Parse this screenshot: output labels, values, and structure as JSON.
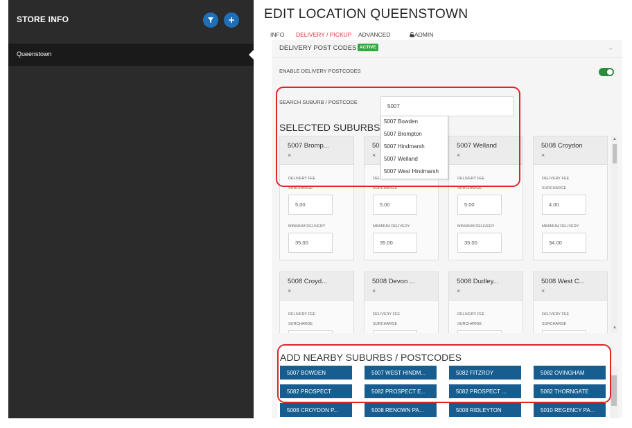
{
  "sidebar": {
    "title": "STORE INFO",
    "filter_icon": "filter-icon",
    "add_icon": "plus-icon",
    "items": [
      {
        "label": "Queenstown"
      }
    ]
  },
  "page": {
    "title": "EDIT LOCATION QUEENSTOWN"
  },
  "tabs": [
    {
      "label": "INFO"
    },
    {
      "label": "DELIVERY / PICKUP"
    },
    {
      "label": "ADVANCED"
    },
    {
      "label": "ADMIN"
    }
  ],
  "delivery": {
    "section_title": "DELIVERY POST CODES",
    "status_badge": "ACTIVE",
    "enable_label": "ENABLE DELIVERY POSTCODES",
    "enabled": true,
    "search_label": "SEARCH SUBURB / POSTCODE",
    "search_value": "5007",
    "selected_heading": "SELECTED SUBURBS",
    "suggestions": [
      "5007 Bowden",
      "5007 Brompton",
      "5007 Hindmarsh",
      "5007 Welland",
      "5007 West Hindmarsh"
    ],
    "fee_label": "DELIVERY FEE",
    "surcharge_label": "SURCHARGE",
    "min_label": "MINIMUM DELIVERY",
    "remove_symbol": "×",
    "cards": [
      {
        "name": "5007 Bromp...",
        "surcharge": "5.00",
        "minimum": "35.00"
      },
      {
        "name": "50",
        "surcharge": "5.00",
        "minimum": "35.00"
      },
      {
        "name": "5007 Welland",
        "surcharge": "5.00",
        "minimum": "35.00"
      },
      {
        "name": "5008 Croydon",
        "surcharge": "4.00",
        "minimum": "34.00"
      },
      {
        "name": "5008 Croyd...",
        "surcharge": "",
        "minimum": ""
      },
      {
        "name": "5008 Devon ...",
        "surcharge": "",
        "minimum": ""
      },
      {
        "name": "5008 Dudley...",
        "surcharge": "",
        "minimum": ""
      },
      {
        "name": "5008 West C...",
        "surcharge": "",
        "minimum": ""
      }
    ]
  },
  "nearby": {
    "title": "ADD NEARBY SUBURBS / POSTCODES",
    "buttons": [
      "5007 BOWDEN",
      "5007 WEST HINDM...",
      "5082 FITZROY",
      "5082 OVINGHAM",
      "5082 PROSPECT",
      "5082 PROSPECT E...",
      "5082 PROSPECT ...",
      "5082 THORNGATE",
      "5008 CROYDON P...",
      "5008 RENOWN PA...",
      "5008 RIDLEYTON",
      "5010 REGENCY PA..."
    ]
  },
  "colors": {
    "accent": "#d9363e",
    "button": "#175d8f",
    "active_badge": "#2eaa3f",
    "highlight": "#e0222b"
  }
}
